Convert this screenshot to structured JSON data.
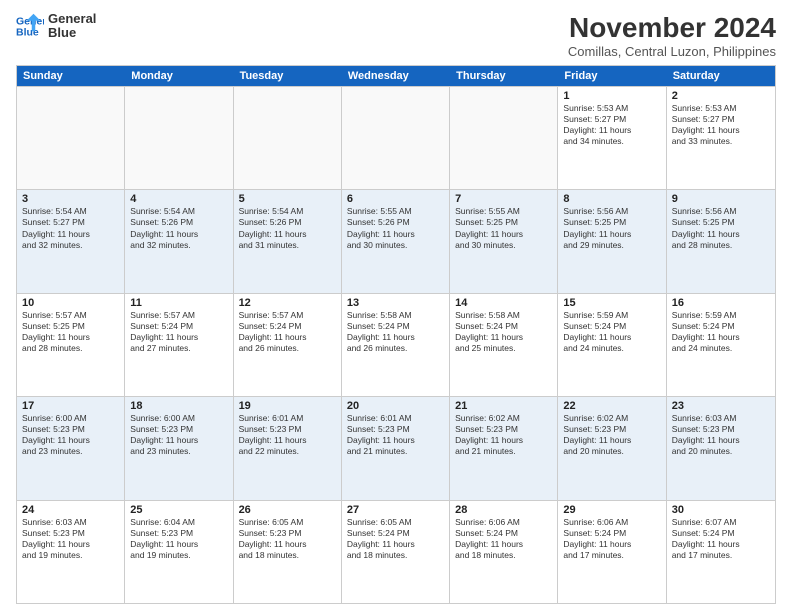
{
  "logo": {
    "line1": "General",
    "line2": "Blue"
  },
  "title": "November 2024",
  "subtitle": "Comillas, Central Luzon, Philippines",
  "days_of_week": [
    "Sunday",
    "Monday",
    "Tuesday",
    "Wednesday",
    "Thursday",
    "Friday",
    "Saturday"
  ],
  "weeks": [
    [
      {
        "day": "",
        "info": ""
      },
      {
        "day": "",
        "info": ""
      },
      {
        "day": "",
        "info": ""
      },
      {
        "day": "",
        "info": ""
      },
      {
        "day": "",
        "info": ""
      },
      {
        "day": "1",
        "info": "Sunrise: 5:53 AM\nSunset: 5:27 PM\nDaylight: 11 hours\nand 34 minutes."
      },
      {
        "day": "2",
        "info": "Sunrise: 5:53 AM\nSunset: 5:27 PM\nDaylight: 11 hours\nand 33 minutes."
      }
    ],
    [
      {
        "day": "3",
        "info": "Sunrise: 5:54 AM\nSunset: 5:27 PM\nDaylight: 11 hours\nand 32 minutes."
      },
      {
        "day": "4",
        "info": "Sunrise: 5:54 AM\nSunset: 5:26 PM\nDaylight: 11 hours\nand 32 minutes."
      },
      {
        "day": "5",
        "info": "Sunrise: 5:54 AM\nSunset: 5:26 PM\nDaylight: 11 hours\nand 31 minutes."
      },
      {
        "day": "6",
        "info": "Sunrise: 5:55 AM\nSunset: 5:26 PM\nDaylight: 11 hours\nand 30 minutes."
      },
      {
        "day": "7",
        "info": "Sunrise: 5:55 AM\nSunset: 5:25 PM\nDaylight: 11 hours\nand 30 minutes."
      },
      {
        "day": "8",
        "info": "Sunrise: 5:56 AM\nSunset: 5:25 PM\nDaylight: 11 hours\nand 29 minutes."
      },
      {
        "day": "9",
        "info": "Sunrise: 5:56 AM\nSunset: 5:25 PM\nDaylight: 11 hours\nand 28 minutes."
      }
    ],
    [
      {
        "day": "10",
        "info": "Sunrise: 5:57 AM\nSunset: 5:25 PM\nDaylight: 11 hours\nand 28 minutes."
      },
      {
        "day": "11",
        "info": "Sunrise: 5:57 AM\nSunset: 5:24 PM\nDaylight: 11 hours\nand 27 minutes."
      },
      {
        "day": "12",
        "info": "Sunrise: 5:57 AM\nSunset: 5:24 PM\nDaylight: 11 hours\nand 26 minutes."
      },
      {
        "day": "13",
        "info": "Sunrise: 5:58 AM\nSunset: 5:24 PM\nDaylight: 11 hours\nand 26 minutes."
      },
      {
        "day": "14",
        "info": "Sunrise: 5:58 AM\nSunset: 5:24 PM\nDaylight: 11 hours\nand 25 minutes."
      },
      {
        "day": "15",
        "info": "Sunrise: 5:59 AM\nSunset: 5:24 PM\nDaylight: 11 hours\nand 24 minutes."
      },
      {
        "day": "16",
        "info": "Sunrise: 5:59 AM\nSunset: 5:24 PM\nDaylight: 11 hours\nand 24 minutes."
      }
    ],
    [
      {
        "day": "17",
        "info": "Sunrise: 6:00 AM\nSunset: 5:23 PM\nDaylight: 11 hours\nand 23 minutes."
      },
      {
        "day": "18",
        "info": "Sunrise: 6:00 AM\nSunset: 5:23 PM\nDaylight: 11 hours\nand 23 minutes."
      },
      {
        "day": "19",
        "info": "Sunrise: 6:01 AM\nSunset: 5:23 PM\nDaylight: 11 hours\nand 22 minutes."
      },
      {
        "day": "20",
        "info": "Sunrise: 6:01 AM\nSunset: 5:23 PM\nDaylight: 11 hours\nand 21 minutes."
      },
      {
        "day": "21",
        "info": "Sunrise: 6:02 AM\nSunset: 5:23 PM\nDaylight: 11 hours\nand 21 minutes."
      },
      {
        "day": "22",
        "info": "Sunrise: 6:02 AM\nSunset: 5:23 PM\nDaylight: 11 hours\nand 20 minutes."
      },
      {
        "day": "23",
        "info": "Sunrise: 6:03 AM\nSunset: 5:23 PM\nDaylight: 11 hours\nand 20 minutes."
      }
    ],
    [
      {
        "day": "24",
        "info": "Sunrise: 6:03 AM\nSunset: 5:23 PM\nDaylight: 11 hours\nand 19 minutes."
      },
      {
        "day": "25",
        "info": "Sunrise: 6:04 AM\nSunset: 5:23 PM\nDaylight: 11 hours\nand 19 minutes."
      },
      {
        "day": "26",
        "info": "Sunrise: 6:05 AM\nSunset: 5:23 PM\nDaylight: 11 hours\nand 18 minutes."
      },
      {
        "day": "27",
        "info": "Sunrise: 6:05 AM\nSunset: 5:24 PM\nDaylight: 11 hours\nand 18 minutes."
      },
      {
        "day": "28",
        "info": "Sunrise: 6:06 AM\nSunset: 5:24 PM\nDaylight: 11 hours\nand 18 minutes."
      },
      {
        "day": "29",
        "info": "Sunrise: 6:06 AM\nSunset: 5:24 PM\nDaylight: 11 hours\nand 17 minutes."
      },
      {
        "day": "30",
        "info": "Sunrise: 6:07 AM\nSunset: 5:24 PM\nDaylight: 11 hours\nand 17 minutes."
      }
    ]
  ]
}
